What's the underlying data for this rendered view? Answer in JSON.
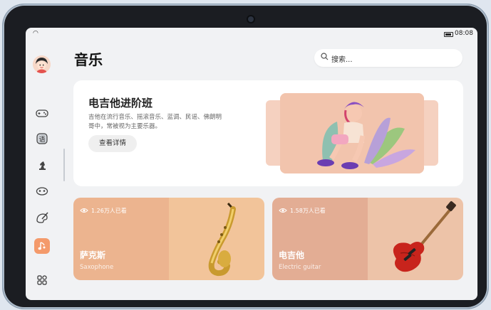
{
  "status": {
    "time": "08:08"
  },
  "page": {
    "title": "音乐"
  },
  "search": {
    "placeholder": "搜索..."
  },
  "sidebar": {
    "items": [
      {
        "icon": "gamepad-icon",
        "glyph": "🎮"
      },
      {
        "icon": "language-icon",
        "glyph": "语"
      },
      {
        "icon": "chess-icon",
        "glyph": "♞"
      },
      {
        "icon": "mask-icon",
        "glyph": "◍"
      },
      {
        "icon": "paint-icon",
        "glyph": "✎"
      },
      {
        "icon": "music-icon",
        "glyph": "♪",
        "active": true
      },
      {
        "icon": "apps-icon",
        "glyph": "⁘"
      }
    ]
  },
  "hero": {
    "title": "电吉他进阶班",
    "description": "吉他在流行音乐、摇滚音乐、蓝调、民谣、佛朗明哥中，常被视为主要乐器。",
    "button": "查看详情"
  },
  "cards": [
    {
      "views": "1.26万人已看",
      "name": "萨克斯",
      "name_en": "Saxophone",
      "color_left": "#ecb48f",
      "color_right": "#f2c49a"
    },
    {
      "views": "1.58万人已看",
      "name": "电吉他",
      "name_en": "Electric guitar",
      "color_left": "#e3ad94",
      "color_right": "#edc3a8"
    }
  ],
  "colors": {
    "accent": "#f49a6b",
    "background": "#f1f2f4"
  }
}
